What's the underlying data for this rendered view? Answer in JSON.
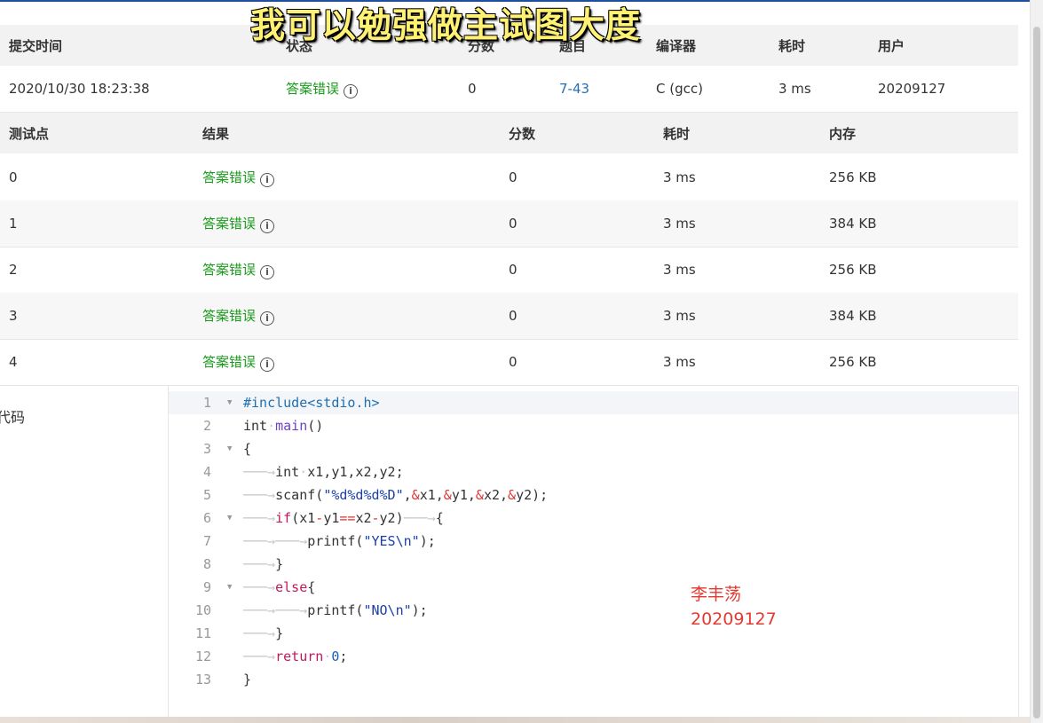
{
  "overlay_title": "我可以勉强做主试图大度",
  "submission": {
    "headers": [
      "提交时间",
      "状态",
      "分数",
      "题目",
      "编译器",
      "耗时",
      "用户"
    ],
    "time": "2020/10/30 18:23:38",
    "status": "答案错误",
    "score": "0",
    "problem": "7-43",
    "compiler": "C (gcc)",
    "elapsed": "3 ms",
    "user": "20209127"
  },
  "testcases": {
    "headers": [
      "测试点",
      "结果",
      "分数",
      "耗时",
      "内存"
    ],
    "rows": [
      {
        "id": "0",
        "result": "答案错误",
        "score": "0",
        "time": "3 ms",
        "memory": "256 KB"
      },
      {
        "id": "1",
        "result": "答案错误",
        "score": "0",
        "time": "3 ms",
        "memory": "384 KB"
      },
      {
        "id": "2",
        "result": "答案错误",
        "score": "0",
        "time": "3 ms",
        "memory": "256 KB"
      },
      {
        "id": "3",
        "result": "答案错误",
        "score": "0",
        "time": "3 ms",
        "memory": "384 KB"
      },
      {
        "id": "4",
        "result": "答案错误",
        "score": "0",
        "time": "3 ms",
        "memory": "256 KB"
      }
    ]
  },
  "code_label": "代码",
  "code_lines": [
    "#include<stdio.h>",
    "int main()",
    "{",
    "int x1,y1,x2,y2;",
    "scanf(\"%d%d%d%D\",&x1,&y1,&x2,&y2);",
    "if(x1-y1==x2-y2)    {",
    "printf(\"YES\\n\");",
    "}",
    "else{",
    "printf(\"NO\\n\");",
    "}",
    "return 0;",
    "}"
  ],
  "annotation": {
    "name": "李丰荡",
    "id": "20209127"
  },
  "colors": {
    "wrong_answer": "#1a9a1a",
    "link": "#2a6fb3",
    "annotation": "#e5392f",
    "overlay": "#fff173"
  }
}
